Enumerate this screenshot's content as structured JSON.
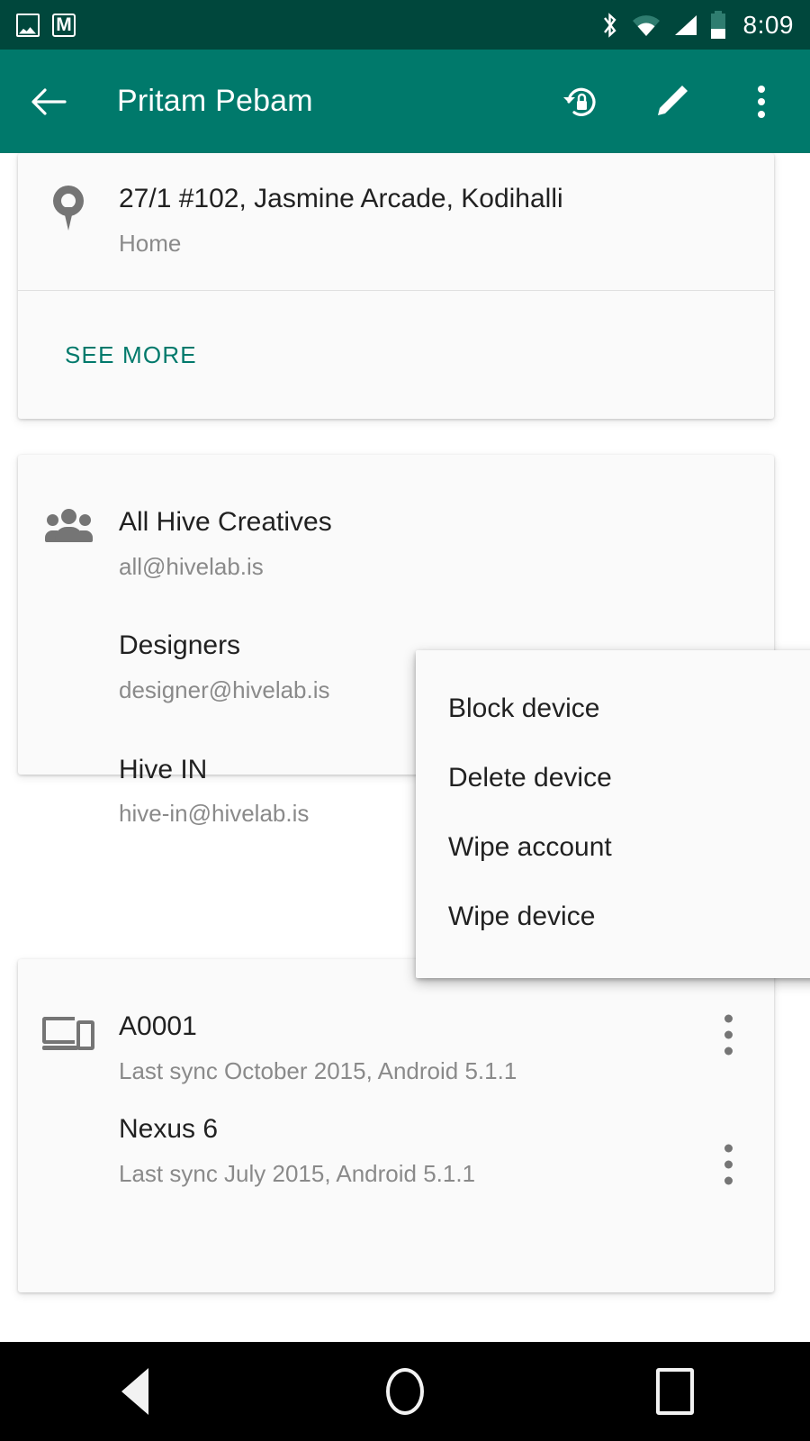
{
  "status_bar": {
    "notification_icons": [
      "screenshot-icon",
      "gmail-icon"
    ],
    "system_icons": [
      "bluetooth-icon",
      "wifi-icon",
      "cellular-signal-icon",
      "battery-icon"
    ],
    "time": "8:09"
  },
  "app_bar": {
    "back_label": "",
    "title": "Pritam Pebam",
    "actions": [
      {
        "name": "reset-password-icon",
        "label": ""
      },
      {
        "name": "edit-icon",
        "label": ""
      },
      {
        "name": "overflow-menu-icon",
        "label": ""
      }
    ]
  },
  "address_card": {
    "icon": "location-pin-icon",
    "address": "27/1 #102, Jasmine Arcade, Kodihalli",
    "type": "Home",
    "see_more": "SEE MORE"
  },
  "groups_card": {
    "icon": "people-icon",
    "items": [
      {
        "name": "All Hive Creatives",
        "email": "all@hivelab.is"
      },
      {
        "name": "Designers",
        "email": "designer@hivelab.is"
      },
      {
        "name": "Hive IN",
        "email": "hive-in@hivelab.is"
      }
    ]
  },
  "devices_card": {
    "icon": "devices-icon",
    "items": [
      {
        "name": "A0001",
        "sync": "Last sync October 2015, Android 5.1.1"
      },
      {
        "name": "Nexus 6",
        "sync": "Last sync July 2015, Android 5.1.1"
      }
    ]
  },
  "popup_menu": {
    "items": [
      "Block device",
      "Delete device",
      "Wipe account",
      "Wipe device"
    ]
  },
  "nav_bar": {
    "buttons": [
      "back-nav-icon",
      "home-nav-icon",
      "recents-nav-icon"
    ]
  },
  "colors": {
    "status_bar": "#00473c",
    "app_bar": "#00796b",
    "accent": "#00796b",
    "card_bg": "#fafafa",
    "page_bg": "#ffffff",
    "primary_text": "#212121",
    "secondary_text": "#8a8a8a",
    "nav_bar": "#000000"
  }
}
